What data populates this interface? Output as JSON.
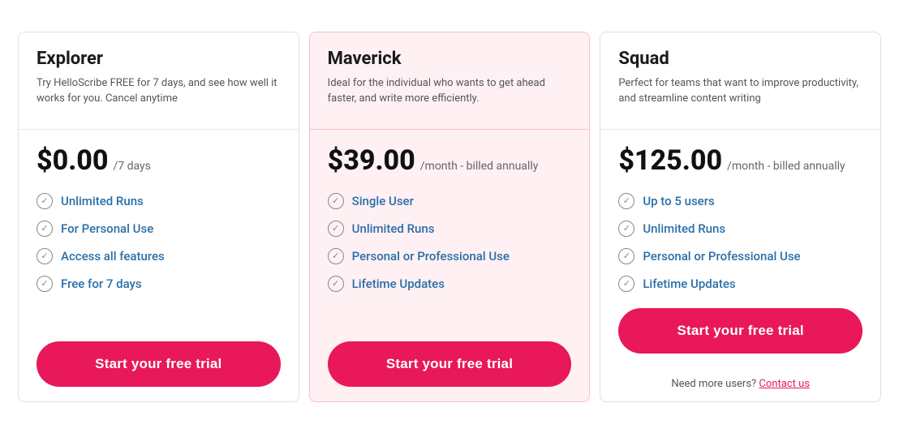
{
  "plans": [
    {
      "id": "explorer",
      "name": "Explorer",
      "description": "Try HelloScribe  FREE for 7 days, and see how well it works for you. Cancel anytime",
      "price": "$0.00",
      "period": "/7 days",
      "featured": false,
      "features": [
        "Unlimited Runs",
        "For Personal Use",
        "Access all features",
        "Free for 7 days"
      ],
      "cta": "Start your free trial",
      "footer": null
    },
    {
      "id": "maverick",
      "name": "Maverick",
      "description": "Ideal for the individual who wants to get ahead faster, and write more efficiently.",
      "price": "$39.00",
      "period": "/month - billed annually",
      "featured": true,
      "features": [
        "Single User",
        "Unlimited Runs",
        "Personal or Professional Use",
        "Lifetime Updates"
      ],
      "cta": "Start your free trial",
      "footer": null
    },
    {
      "id": "squad",
      "name": "Squad",
      "description": "Perfect for teams that want to improve productivity, and streamline content writing",
      "price": "$125.00",
      "period": "/month - billed annually",
      "featured": false,
      "features": [
        "Up to 5 users",
        "Unlimited Runs",
        "Personal or Professional Use",
        "Lifetime Updates"
      ],
      "cta": "Start your free trial",
      "footer": {
        "text": "Need more users?",
        "link_text": "Contact us"
      }
    }
  ],
  "icons": {
    "check": "✓"
  }
}
